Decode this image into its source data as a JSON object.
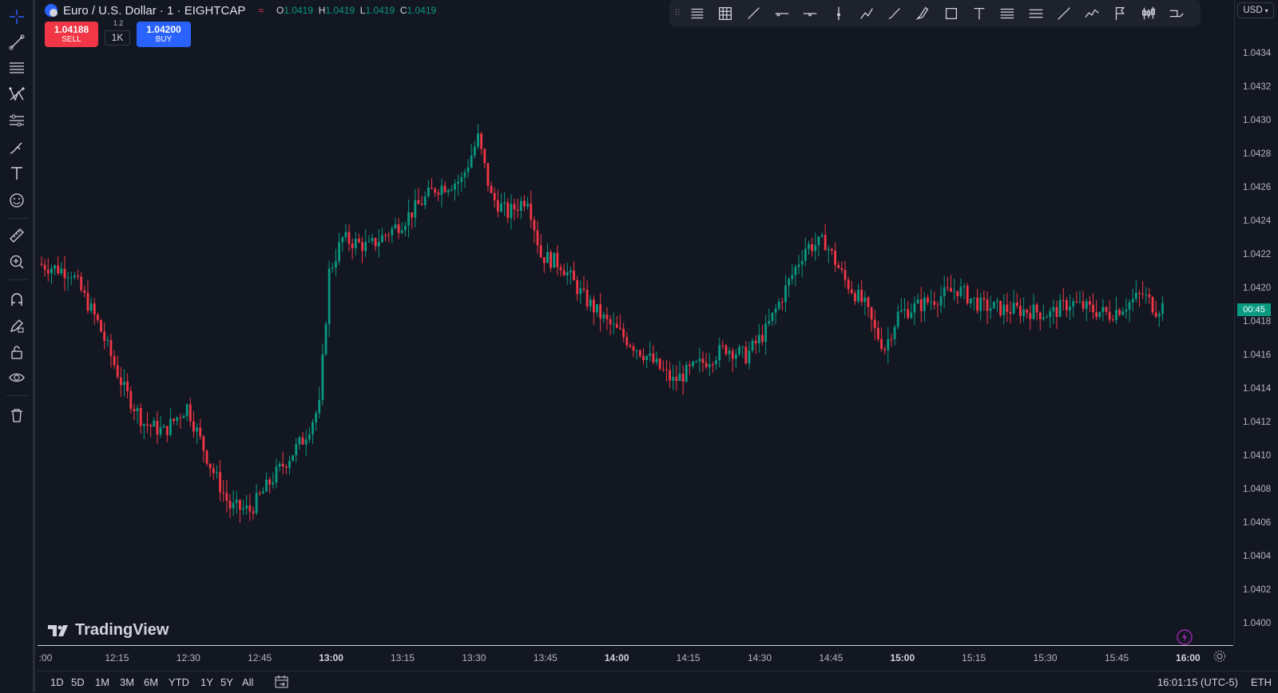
{
  "symbol": {
    "title": "Euro / U.S. Dollar · 1 · EIGHTCAP",
    "ohlc": [
      {
        "key": "O",
        "value": "1.0419"
      },
      {
        "key": "H",
        "value": "1.0419"
      },
      {
        "key": "L",
        "value": "1.0419"
      },
      {
        "key": "C",
        "value": "1.0419"
      }
    ]
  },
  "trade": {
    "sell_price": "1.04188",
    "sell_label": "SELL",
    "buy_price": "1.04200",
    "buy_label": "BUY",
    "spread": "1.2",
    "quantity": "1K"
  },
  "price_scale": {
    "currency": "USD",
    "labels": [
      "1.0434",
      "1.0432",
      "1.0430",
      "1.0428",
      "1.0426",
      "1.0424",
      "1.0422",
      "1.0420",
      "1.0418",
      "1.0416",
      "1.0414",
      "1.0412",
      "1.0410",
      "1.0408",
      "1.0406",
      "1.0404",
      "1.0402",
      "1.0400"
    ],
    "countdown": "00:45"
  },
  "time_axis": {
    "labels": [
      {
        "text": ":00",
        "bold": false
      },
      {
        "text": "12:15",
        "bold": false
      },
      {
        "text": "12:30",
        "bold": false
      },
      {
        "text": "12:45",
        "bold": false
      },
      {
        "text": "13:00",
        "bold": true
      },
      {
        "text": "13:15",
        "bold": false
      },
      {
        "text": "13:30",
        "bold": false
      },
      {
        "text": "13:45",
        "bold": false
      },
      {
        "text": "14:00",
        "bold": true
      },
      {
        "text": "14:15",
        "bold": false
      },
      {
        "text": "14:30",
        "bold": false
      },
      {
        "text": "14:45",
        "bold": false
      },
      {
        "text": "15:00",
        "bold": true
      },
      {
        "text": "15:15",
        "bold": false
      },
      {
        "text": "15:30",
        "bold": false
      },
      {
        "text": "15:45",
        "bold": false
      },
      {
        "text": "16:00",
        "bold": true
      }
    ]
  },
  "bottom_bar": {
    "ranges": [
      "1D",
      "5D",
      "1M",
      "3M",
      "6M",
      "YTD",
      "1Y",
      "5Y",
      "All"
    ],
    "clock": "16:01:15 (UTC-5)",
    "session": "ETH"
  },
  "watermark": "TradingView",
  "colors": {
    "background": "#131722",
    "up": "#089981",
    "down": "#f23645",
    "buy": "#2962ff"
  },
  "left_tools": [
    "crosshair-icon",
    "trend-line-icon",
    "fib-retracement-icon",
    "pattern-icon",
    "prediction-icon",
    "brush-icon",
    "text-icon",
    "emoji-icon",
    "ruler-icon",
    "zoom-in-icon",
    "magnet-icon",
    "lock-drawing-icon",
    "lock-icon",
    "eye-icon",
    "trash-icon"
  ],
  "drawing_toolbar": [
    "horizontal-lines-icon",
    "grid-icon",
    "trend-line-icon",
    "horizontal-ray-icon",
    "horizontal-line-icon",
    "vertical-line-icon",
    "path-icon",
    "brush-icon",
    "highlighter-icon",
    "rectangle-icon",
    "text-icon",
    "fib-channel-icon",
    "fib-levels-icon",
    "ray-icon",
    "polyline-icon",
    "flag-icon",
    "candles-icon",
    "long-position-icon"
  ]
}
